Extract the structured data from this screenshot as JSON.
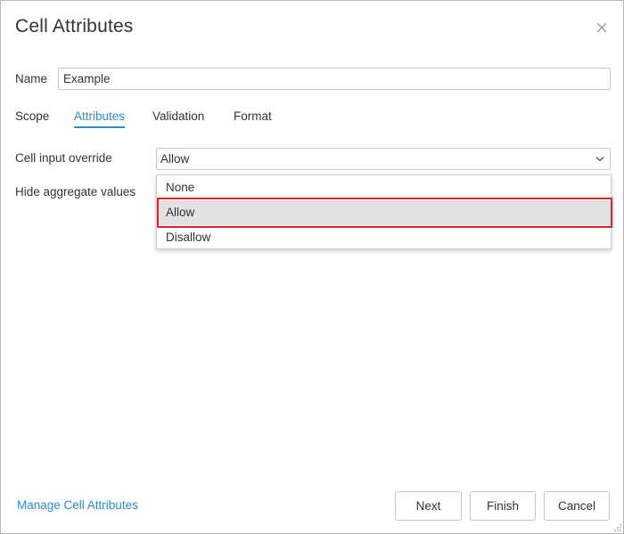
{
  "dialog": {
    "title": "Cell Attributes"
  },
  "name_field": {
    "label": "Name",
    "value": "Example"
  },
  "tabs": [
    {
      "label": "Scope",
      "active": false
    },
    {
      "label": "Attributes",
      "active": true
    },
    {
      "label": "Validation",
      "active": false
    },
    {
      "label": "Format",
      "active": false
    }
  ],
  "fields": {
    "cell_input_override": {
      "label": "Cell input override",
      "value": "Allow"
    },
    "hide_aggregate_values": {
      "label": "Hide aggregate values"
    }
  },
  "dropdown": {
    "options": [
      "None",
      "Allow",
      "Disallow"
    ],
    "selected": "Allow"
  },
  "footer": {
    "manage_link": "Manage Cell Attributes",
    "next_label": "Next",
    "finish_label": "Finish",
    "cancel_label": "Cancel"
  },
  "colors": {
    "accent": "#2a8fc4",
    "highlight": "#e0202a",
    "selected_option_bg": "#e2e2e2"
  },
  "icons": {
    "close": "close-icon",
    "dropdown": "chevron-down-icon",
    "resize": "resize-grip-icon"
  }
}
